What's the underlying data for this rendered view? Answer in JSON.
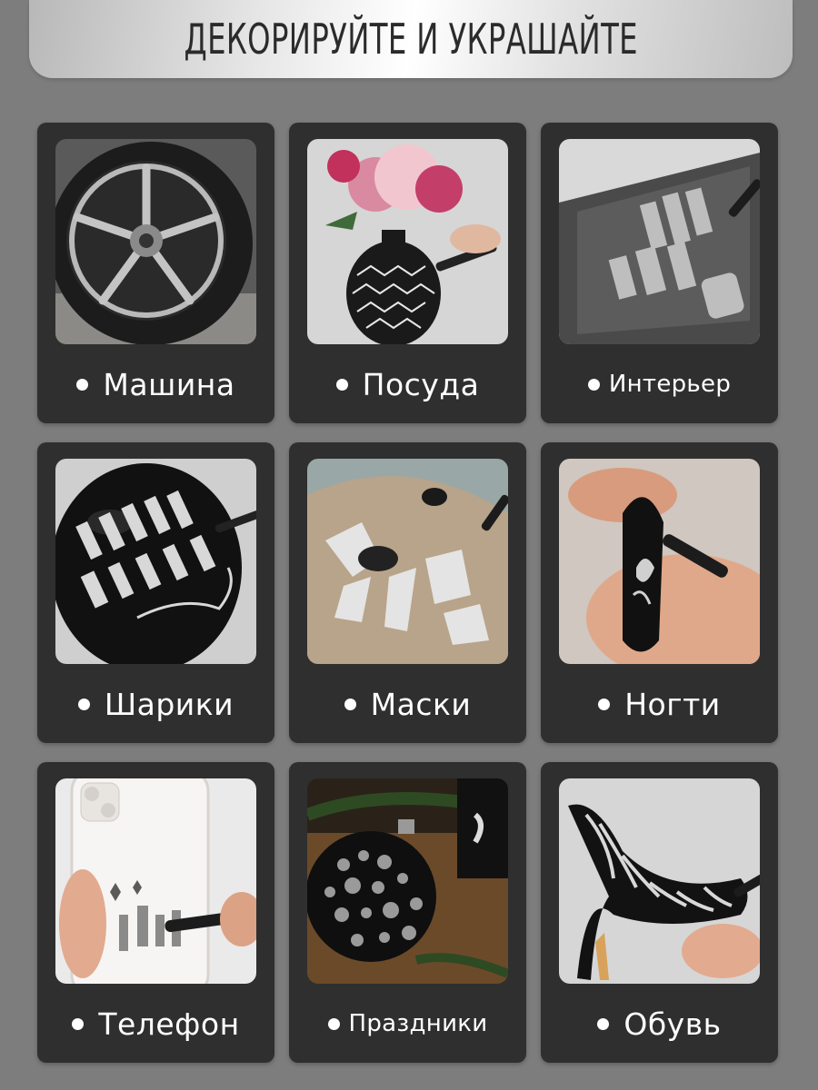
{
  "header": {
    "title": "ДЕКОРИРУЙТЕ И УКРАШАЙТЕ"
  },
  "colors": {
    "background": "#7d7d7d",
    "card": "#2f2f2f",
    "text": "#ffffff"
  },
  "cards": [
    {
      "label": "Машина",
      "icon": "car-wheel-photo"
    },
    {
      "label": "Посуда",
      "icon": "decorated-vase-photo"
    },
    {
      "label": "Интерьер",
      "icon": "mirror-lettering-photo"
    },
    {
      "label": "Шарики",
      "icon": "birthday-balloon-photo"
    },
    {
      "label": "Маски",
      "icon": "painted-mask-photo"
    },
    {
      "label": "Ногти",
      "icon": "painted-nail-photo"
    },
    {
      "label": "Телефон",
      "icon": "phone-case-photo"
    },
    {
      "label": "Праздники",
      "icon": "christmas-ornament-photo"
    },
    {
      "label": "Обувь",
      "icon": "high-heel-shoe-photo"
    }
  ]
}
